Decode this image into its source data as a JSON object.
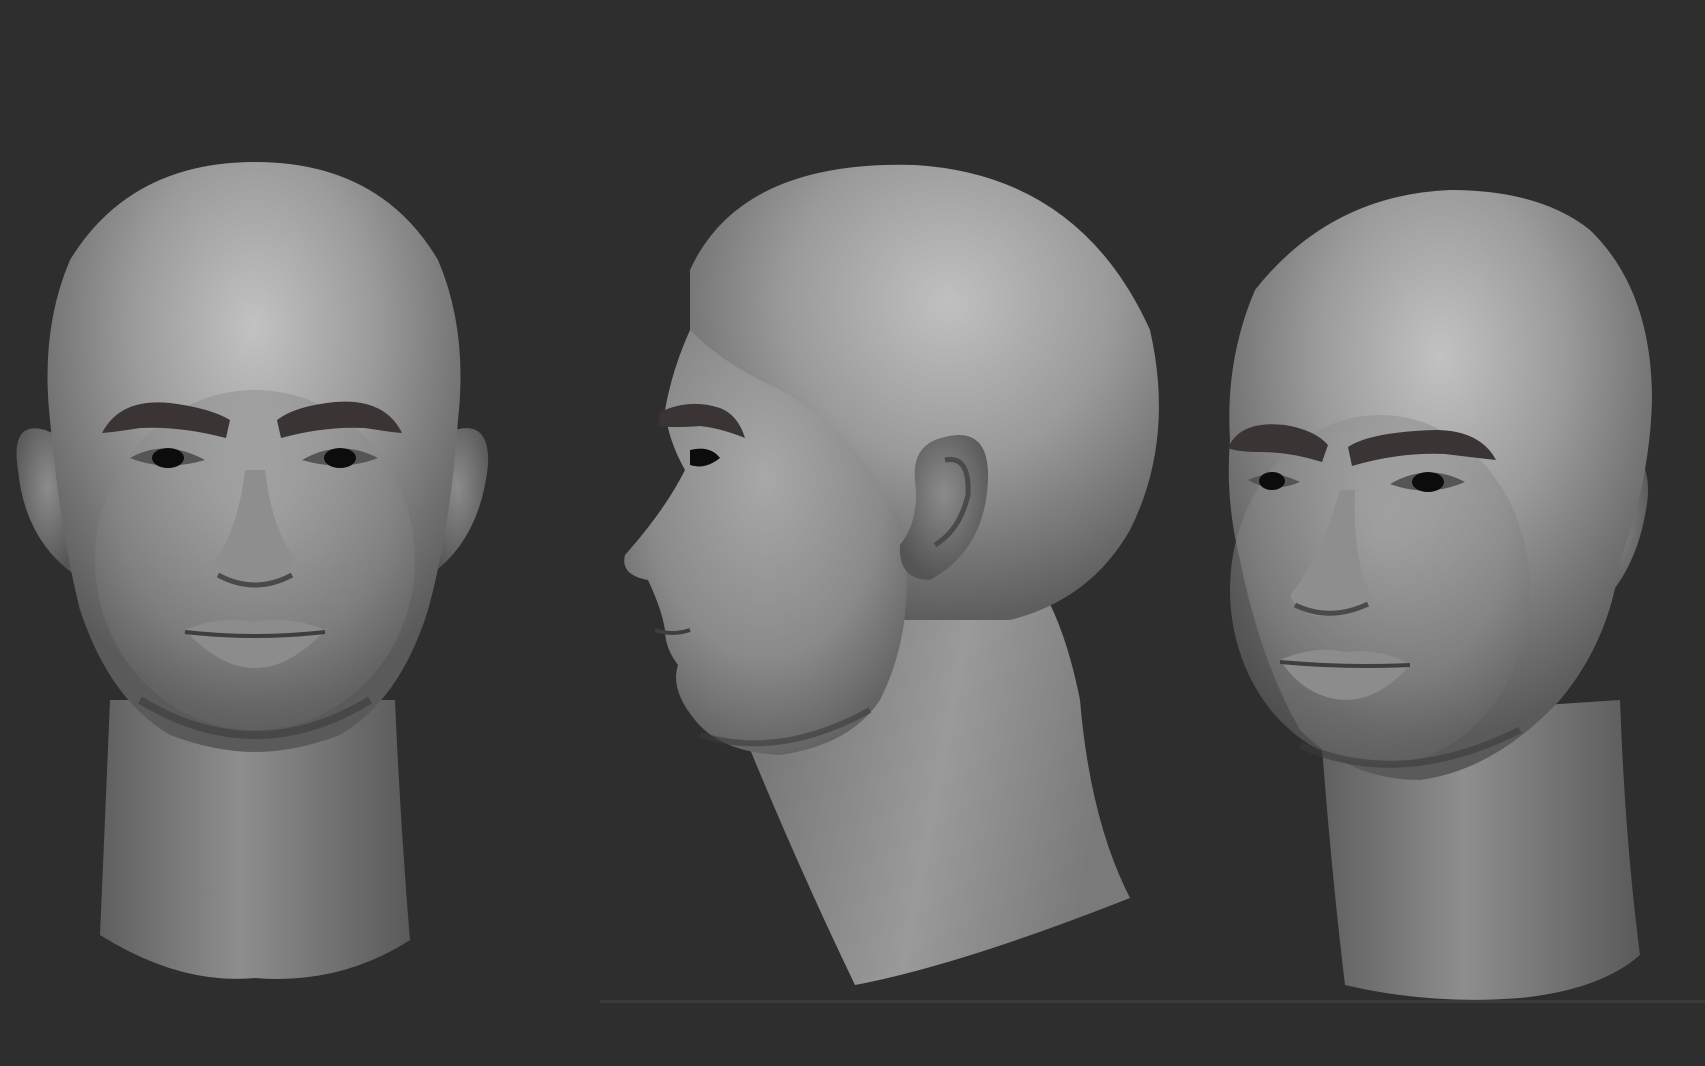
{
  "viewport": {
    "background": "#2e2e2e",
    "sculpt_material_color": "#8a8a8a",
    "brow_color": "#3a3434"
  },
  "views": [
    {
      "name": "front-view"
    },
    {
      "name": "side-view"
    },
    {
      "name": "three-quarter-view"
    }
  ]
}
